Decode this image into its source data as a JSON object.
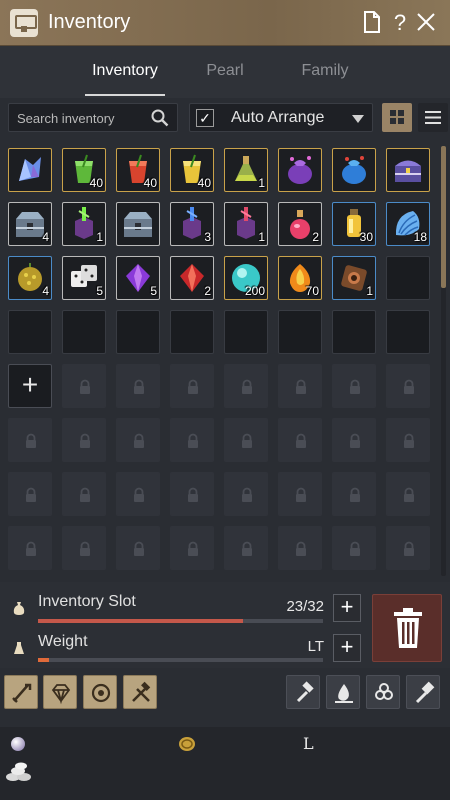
{
  "header": {
    "title": "Inventory"
  },
  "tabs": [
    {
      "label": "Inventory",
      "active": true
    },
    {
      "label": "Pearl",
      "active": false
    },
    {
      "label": "Family",
      "active": false
    }
  ],
  "toolbar": {
    "search_placeholder": "Search inventory",
    "auto_arrange_label": "Auto Arrange",
    "auto_arrange_checked": true
  },
  "inventory": {
    "rows": [
      [
        {
          "icon": "blue-crystal",
          "qty": "",
          "frame": "gold"
        },
        {
          "icon": "green-drink",
          "qty": "40",
          "frame": "gold"
        },
        {
          "icon": "red-drink",
          "qty": "40",
          "frame": "gold"
        },
        {
          "icon": "yellow-drink",
          "qty": "40",
          "frame": "gold"
        },
        {
          "icon": "potion-flask",
          "qty": "1",
          "frame": "gold"
        },
        {
          "icon": "purple-pouch",
          "qty": "",
          "frame": "gold"
        },
        {
          "icon": "blue-pouch",
          "qty": "",
          "frame": "gold"
        },
        {
          "icon": "treasure-chest",
          "qty": "",
          "frame": "gold"
        }
      ],
      [
        {
          "icon": "steel-chest",
          "qty": "4",
          "frame": "white"
        },
        {
          "icon": "green-box",
          "qty": "1",
          "frame": "white"
        },
        {
          "icon": "steel-chest",
          "qty": "",
          "frame": "white"
        },
        {
          "icon": "blue-box",
          "qty": "3",
          "frame": "white"
        },
        {
          "icon": "red-box",
          "qty": "1",
          "frame": "white"
        },
        {
          "icon": "red-potion",
          "qty": "2",
          "frame": "white"
        },
        {
          "icon": "yellow-potion",
          "qty": "30",
          "frame": "blue"
        },
        {
          "icon": "blue-shell",
          "qty": "18",
          "frame": "blue"
        }
      ],
      [
        {
          "icon": "durian-fruit",
          "qty": "4",
          "frame": "blue"
        },
        {
          "icon": "dice",
          "qty": "5",
          "frame": "white"
        },
        {
          "icon": "purple-gem",
          "qty": "5",
          "frame": "white"
        },
        {
          "icon": "red-gem",
          "qty": "2",
          "frame": "white"
        },
        {
          "icon": "cyan-orb",
          "qty": "200",
          "frame": "gold"
        },
        {
          "icon": "amber-gem",
          "qty": "70",
          "frame": "gold"
        },
        {
          "icon": "bronze-ring",
          "qty": "1",
          "frame": "blue"
        },
        {
          "icon": "",
          "qty": "",
          "frame": "empty"
        }
      ]
    ],
    "empty_slots": 8,
    "locked_rows": 4
  },
  "stats": {
    "slot_label": "Inventory Slot",
    "slot_value": "23/32",
    "slot_fill": 0.72,
    "weight_label": "Weight",
    "weight_value": "LT",
    "weight_fill": 0.04
  },
  "actions": {
    "left": [
      "sword-icon",
      "diamond-icon",
      "rings-icon",
      "hammer-cross-icon"
    ],
    "right": [
      "hammer-icon",
      "water-drop-icon",
      "triskele-icon",
      "gavel-icon"
    ]
  },
  "currency": {
    "pearl_icon": "pearl-icon",
    "coin_icon": "coin-icon",
    "letter_glyph": "L",
    "silver_icon": "silver-icon"
  },
  "colors": {
    "header": "#8b7558",
    "gold_frame": "#c9a24a",
    "blue_frame": "#4b8bc8",
    "bar_fill": "#c5584a",
    "trash": "#5a2e2a"
  }
}
